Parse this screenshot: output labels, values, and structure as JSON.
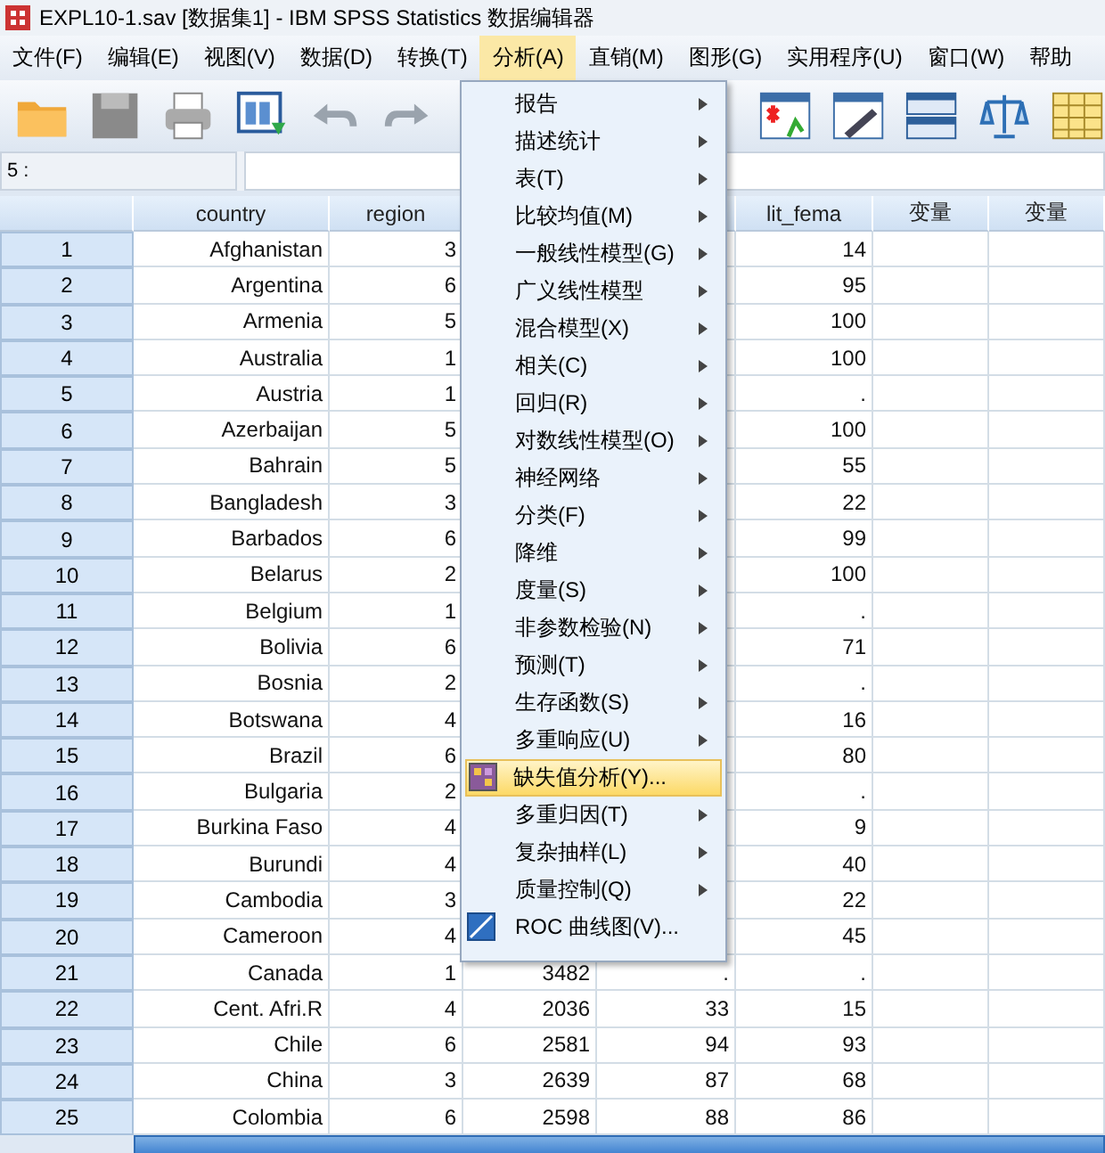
{
  "window": {
    "title": "EXPL10-1.sav [数据集1] - IBM SPSS Statistics 数据编辑器"
  },
  "menubar": [
    {
      "label": "文件(F)",
      "selected": false
    },
    {
      "label": "编辑(E)",
      "selected": false
    },
    {
      "label": "视图(V)",
      "selected": false
    },
    {
      "label": "数据(D)",
      "selected": false
    },
    {
      "label": "转换(T)",
      "selected": false
    },
    {
      "label": "分析(A)",
      "selected": true
    },
    {
      "label": "直销(M)",
      "selected": false
    },
    {
      "label": "图形(G)",
      "selected": false
    },
    {
      "label": "实用程序(U)",
      "selected": false
    },
    {
      "label": "窗口(W)",
      "selected": false
    },
    {
      "label": "帮助",
      "selected": false
    }
  ],
  "cell_editor": {
    "cell": "5 :"
  },
  "table": {
    "headers": {
      "country": "country",
      "region": "region",
      "lit_fema": "lit_fema",
      "column_7": "变量",
      "column_8": "变量"
    },
    "rows": [
      {
        "n": "1",
        "country": "Afghanistan",
        "region": "3",
        "lit_fema": "14"
      },
      {
        "n": "2",
        "country": "Argentina",
        "region": "6",
        "lit_fema": "95"
      },
      {
        "n": "3",
        "country": "Armenia",
        "region": "5",
        "lit_fema": "100"
      },
      {
        "n": "4",
        "country": "Australia",
        "region": "1",
        "lit_fema": "100"
      },
      {
        "n": "5",
        "country": "Austria",
        "region": "1",
        "lit_fema": "."
      },
      {
        "n": "6",
        "country": "Azerbaijan",
        "region": "5",
        "lit_fema": "100"
      },
      {
        "n": "7",
        "country": "Bahrain",
        "region": "5",
        "lit_fema": "55"
      },
      {
        "n": "8",
        "country": "Bangladesh",
        "region": "3",
        "lit_fema": "22"
      },
      {
        "n": "9",
        "country": "Barbados",
        "region": "6",
        "lit_fema": "99"
      },
      {
        "n": "10",
        "country": "Belarus",
        "region": "2",
        "lit_fema": "100"
      },
      {
        "n": "11",
        "country": "Belgium",
        "region": "1",
        "lit_fema": "."
      },
      {
        "n": "12",
        "country": "Bolivia",
        "region": "6",
        "lit_fema": "71"
      },
      {
        "n": "13",
        "country": "Bosnia",
        "region": "2",
        "lit_fema": "."
      },
      {
        "n": "14",
        "country": "Botswana",
        "region": "4",
        "lit_fema": "16"
      },
      {
        "n": "15",
        "country": "Brazil",
        "region": "6",
        "lit_fema": "80"
      },
      {
        "n": "16",
        "country": "Bulgaria",
        "region": "2",
        "lit_fema": "."
      },
      {
        "n": "17",
        "country": "Burkina Faso",
        "region": "4",
        "lit_fema": "9"
      },
      {
        "n": "18",
        "country": "Burundi",
        "region": "4",
        "lit_fema": "40"
      },
      {
        "n": "19",
        "country": "Cambodia",
        "region": "3",
        "lit_fema": "22"
      },
      {
        "n": "20",
        "country": "Cameroon",
        "region": "4",
        "lit_fema": "45"
      },
      {
        "n": "21",
        "country": "Canada",
        "region": "1",
        "column_4": "3482",
        "column_5": ".",
        "lit_fema": "."
      },
      {
        "n": "22",
        "country": "Cent. Afri.R",
        "region": "4",
        "column_4": "2036",
        "column_5": "33",
        "lit_fema": "15"
      },
      {
        "n": "23",
        "country": "Chile",
        "region": "6",
        "column_4": "2581",
        "column_5": "94",
        "lit_fema": "93"
      },
      {
        "n": "24",
        "country": "China",
        "region": "3",
        "column_4": "2639",
        "column_5": "87",
        "lit_fema": "68"
      },
      {
        "n": "25",
        "country": "Colombia",
        "region": "6",
        "column_4": "2598",
        "column_5": "88",
        "lit_fema": "86"
      }
    ]
  },
  "analyze_menu": {
    "items": [
      {
        "label": "报告",
        "submenu": true,
        "highlighted": false
      },
      {
        "label": "描述统计",
        "submenu": true,
        "highlighted": false
      },
      {
        "label": "表(T)",
        "submenu": true,
        "highlighted": false
      },
      {
        "label": "比较均值(M)",
        "submenu": true,
        "highlighted": false
      },
      {
        "label": "一般线性模型(G)",
        "submenu": true,
        "highlighted": false
      },
      {
        "label": "广义线性模型",
        "submenu": true,
        "highlighted": false
      },
      {
        "label": "混合模型(X)",
        "submenu": true,
        "highlighted": false
      },
      {
        "label": "相关(C)",
        "submenu": true,
        "highlighted": false
      },
      {
        "label": "回归(R)",
        "submenu": true,
        "highlighted": false
      },
      {
        "label": "对数线性模型(O)",
        "submenu": true,
        "highlighted": false
      },
      {
        "label": "神经网络",
        "submenu": true,
        "highlighted": false
      },
      {
        "label": "分类(F)",
        "submenu": true,
        "highlighted": false
      },
      {
        "label": "降维",
        "submenu": true,
        "highlighted": false
      },
      {
        "label": "度量(S)",
        "submenu": true,
        "highlighted": false
      },
      {
        "label": "非参数检验(N)",
        "submenu": true,
        "highlighted": false
      },
      {
        "label": "预测(T)",
        "submenu": true,
        "highlighted": false
      },
      {
        "label": "生存函数(S)",
        "submenu": true,
        "highlighted": false
      },
      {
        "label": "多重响应(U)",
        "submenu": true,
        "highlighted": false
      },
      {
        "label": "缺失值分析(Y)...",
        "submenu": false,
        "highlighted": true
      },
      {
        "label": "多重归因(T)",
        "submenu": true,
        "highlighted": false
      },
      {
        "label": "复杂抽样(L)",
        "submenu": true,
        "highlighted": false
      },
      {
        "label": "质量控制(Q)",
        "submenu": true,
        "highlighted": false
      },
      {
        "label": "ROC 曲线图(V)...",
        "submenu": false,
        "highlighted": false
      }
    ]
  }
}
